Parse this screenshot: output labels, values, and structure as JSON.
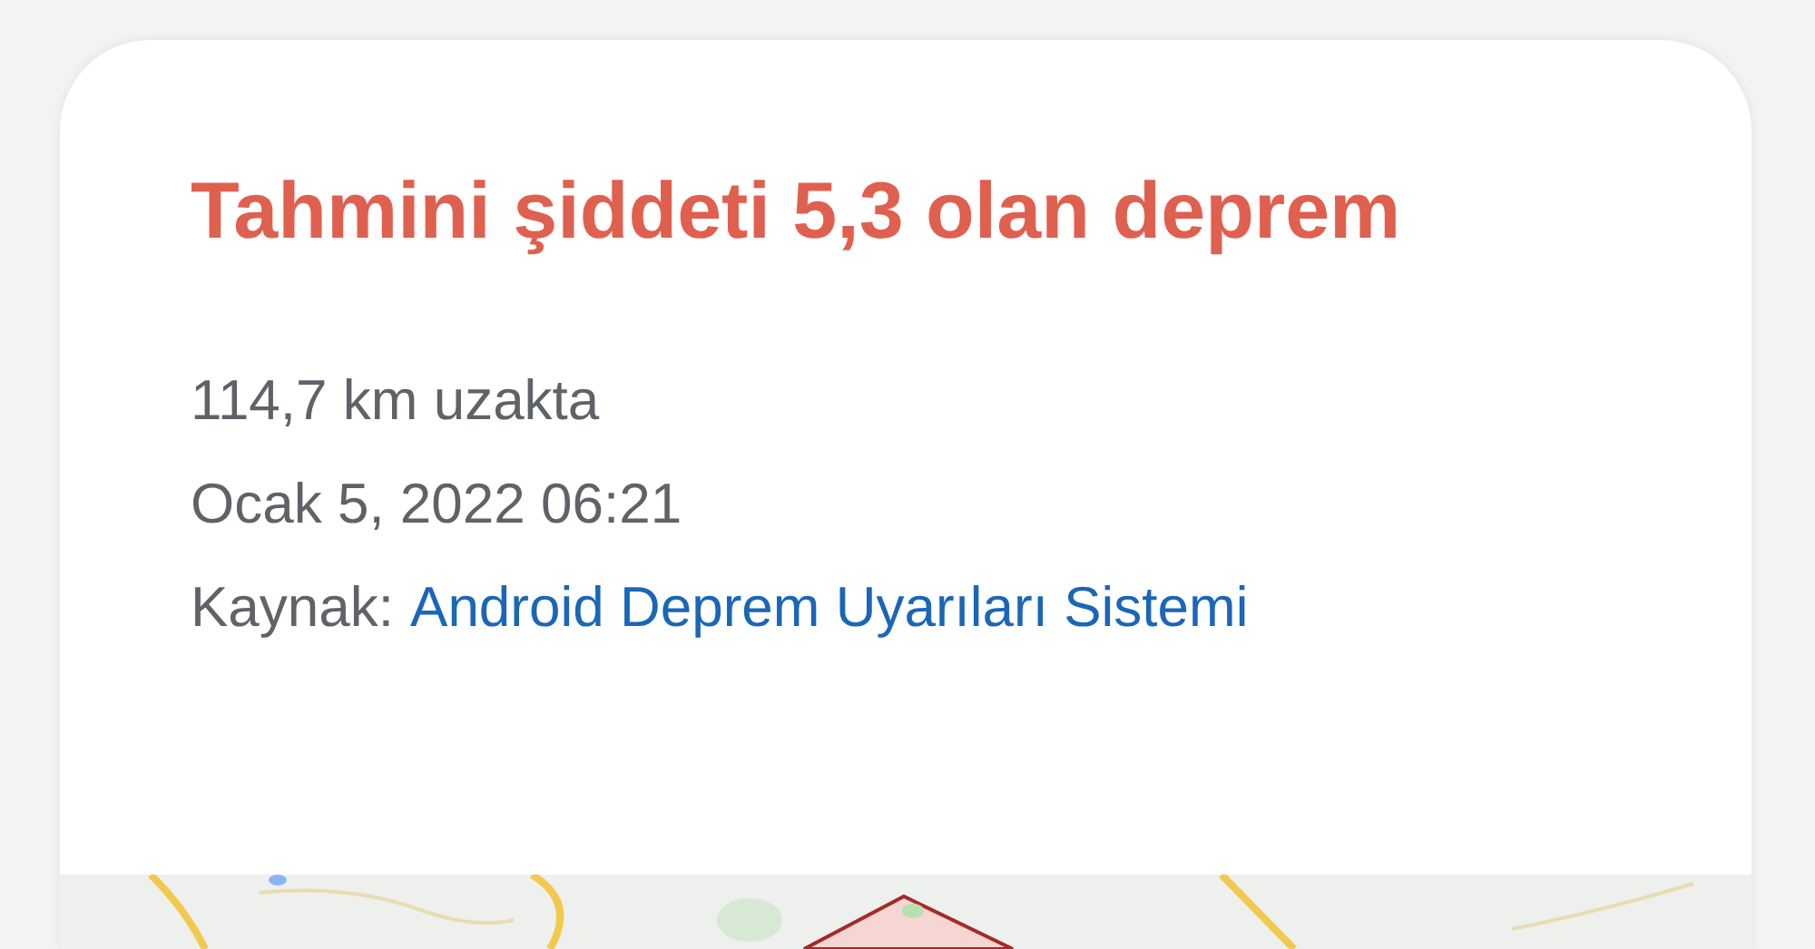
{
  "alert": {
    "title": "Tahmini şiddeti 5,3 olan deprem",
    "distance": "114,7 km uzakta",
    "time": "Ocak 5, 2022 06:21",
    "source": {
      "label": "Kaynak:",
      "link": "Android Deprem Uyarıları Sistemi"
    }
  }
}
